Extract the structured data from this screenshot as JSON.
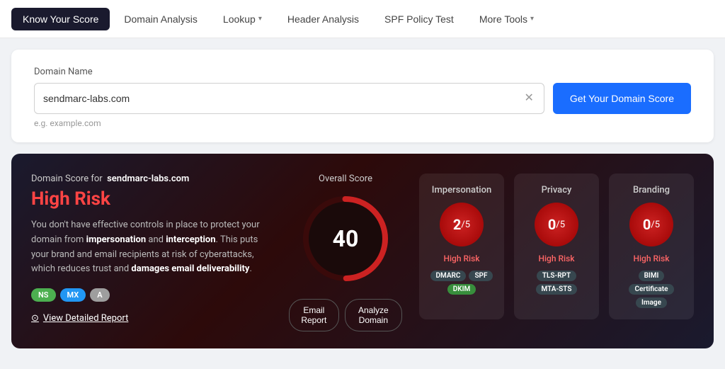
{
  "nav": {
    "items": [
      {
        "id": "know-your-score",
        "label": "Know Your Score",
        "active": true,
        "dropdown": false
      },
      {
        "id": "domain-analysis",
        "label": "Domain Analysis",
        "active": false,
        "dropdown": false
      },
      {
        "id": "lookup",
        "label": "Lookup",
        "active": false,
        "dropdown": true
      },
      {
        "id": "header-analysis",
        "label": "Header Analysis",
        "active": false,
        "dropdown": false
      },
      {
        "id": "spf-policy-test",
        "label": "SPF Policy Test",
        "active": false,
        "dropdown": false
      },
      {
        "id": "more-tools",
        "label": "More Tools",
        "active": false,
        "dropdown": true
      }
    ]
  },
  "search": {
    "domain_label": "Domain Name",
    "input_value": "sendmarc-labs.com",
    "input_placeholder": "e.g. example.com",
    "hint": "e.g. example.com",
    "get_score_button": "Get Your Domain Score"
  },
  "results": {
    "domain_score_prefix": "Domain Score for",
    "domain": "sendmarc-labs.com",
    "risk_level": "High Risk",
    "description": "You don't have effective controls in place to protect your domain from impersonation and interception. This puts your brand and email recipients at risk of cyberattacks, which reduces trust and damages email deliverability.",
    "tags": [
      {
        "label": "NS",
        "class": "tag-ns"
      },
      {
        "label": "MX",
        "class": "tag-mx"
      },
      {
        "label": "A",
        "class": "tag-a"
      }
    ],
    "view_report": "View Detailed Report",
    "overall_score_label": "Overall Score",
    "overall_score": "40",
    "email_report_btn": "Email Report",
    "analyze_domain_btn": "Analyze Domain",
    "cards": [
      {
        "id": "impersonation",
        "title": "Impersonation",
        "score": "2",
        "out_of": "5",
        "risk": "High Risk",
        "tags": [
          {
            "label": "DMARC",
            "class": "ct-dmarc"
          },
          {
            "label": "SPF",
            "class": "ct-spf"
          },
          {
            "label": "DKIM",
            "class": "ct-dkim"
          }
        ]
      },
      {
        "id": "privacy",
        "title": "Privacy",
        "score": "0",
        "out_of": "5",
        "risk": "High Risk",
        "tags": [
          {
            "label": "TLS-RPT",
            "class": "ct-tls"
          },
          {
            "label": "MTA-STS",
            "class": "ct-mta"
          }
        ]
      },
      {
        "id": "branding",
        "title": "Branding",
        "score": "0",
        "out_of": "5",
        "risk": "High Risk",
        "tags": [
          {
            "label": "BIMI",
            "class": "ct-bimi"
          },
          {
            "label": "Certificate",
            "class": "ct-cert"
          },
          {
            "label": "Image",
            "class": "ct-img"
          }
        ]
      }
    ]
  }
}
